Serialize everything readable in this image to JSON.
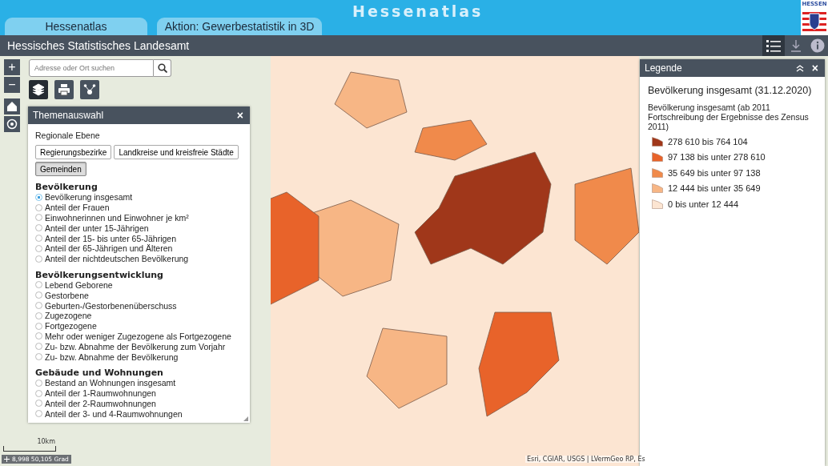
{
  "header": {
    "title": "Hessenatlas",
    "tabs": [
      {
        "label": "Hessenatlas",
        "selected": false
      },
      {
        "label": "Aktion: Gewerbestatistik in 3D",
        "selected": false
      }
    ],
    "logo_text": "HESSEN"
  },
  "toolbar": {
    "title": "Hessisches Statistisches Landesamt"
  },
  "map": {
    "search": {
      "placeholder": "Adresse oder Ort suchen"
    },
    "zoom_in": "+",
    "zoom_out": "−",
    "scale": "10km",
    "coordinates": "8,998 50,105 Grad",
    "attribution": "Esri, CGIAR, USGS | LVermGeo RP, Es"
  },
  "theme_panel": {
    "title": "Themenauswahl",
    "close": "×",
    "level_label": "Regionale Ebene",
    "levels": [
      {
        "label": "Regierungsbezirke",
        "selected": false
      },
      {
        "label": "Landkreise und kreisfreie Städte",
        "selected": false
      },
      {
        "label": "Gemeinden",
        "selected": true
      }
    ],
    "groups": [
      {
        "title": "Bevölkerung",
        "items": [
          {
            "label": "Bevölkerung insgesamt",
            "selected": true
          },
          {
            "label": "Anteil der Frauen",
            "selected": false
          },
          {
            "label": "Einwohnerinnen und Einwohner je km²",
            "selected": false
          },
          {
            "label": "Anteil der unter 15-Jährigen",
            "selected": false
          },
          {
            "label": "Anteil der 15- bis unter 65-Jährigen",
            "selected": false
          },
          {
            "label": "Anteil der 65-Jährigen und Älteren",
            "selected": false
          },
          {
            "label": "Anteil der nichtdeutschen Bevölkerung",
            "selected": false
          }
        ]
      },
      {
        "title": "Bevölkerungsentwicklung",
        "items": [
          {
            "label": "Lebend Geborene",
            "selected": false
          },
          {
            "label": "Gestorbene",
            "selected": false
          },
          {
            "label": "Geburten-/Gestorbenenüberschuss",
            "selected": false
          },
          {
            "label": "Zugezogene",
            "selected": false
          },
          {
            "label": "Fortgezogene",
            "selected": false
          },
          {
            "label": "Mehr oder weniger Zugezogene als Fortgezogene",
            "selected": false
          },
          {
            "label": "Zu- bzw. Abnahme der Bevölkerung zum Vorjahr",
            "selected": false
          },
          {
            "label": "Zu- bzw. Abnahme der Bevölkerung",
            "selected": false
          }
        ]
      },
      {
        "title": "Gebäude und Wohnungen",
        "items": [
          {
            "label": "Bestand an Wohnungen insgesamt",
            "selected": false
          },
          {
            "label": "Anteil der 1-Raumwohnungen",
            "selected": false
          },
          {
            "label": "Anteil der 2-Raumwohnungen",
            "selected": false
          },
          {
            "label": "Anteil der 3- und 4-Raumwohnungen",
            "selected": false
          }
        ]
      }
    ]
  },
  "legend": {
    "title": "Legende",
    "close": "×",
    "heading": "Bevölkerung insgesamt (31.12.2020)",
    "description": "Bevölkerung insgesamt (ab 2011 Fortschreibung der Ergebnisse des Zensus 2011)",
    "classes": [
      {
        "label": "278 610 bis 764 104",
        "color": "#a0371a"
      },
      {
        "label": "97 138 bis unter 278 610",
        "color": "#e8632a"
      },
      {
        "label": "35 649 bis unter 97 138",
        "color": "#f08a4b"
      },
      {
        "label": "12 444 bis unter 35 649",
        "color": "#f7b685"
      },
      {
        "label": "0 bis unter 12 444",
        "color": "#fce5d2"
      }
    ]
  }
}
